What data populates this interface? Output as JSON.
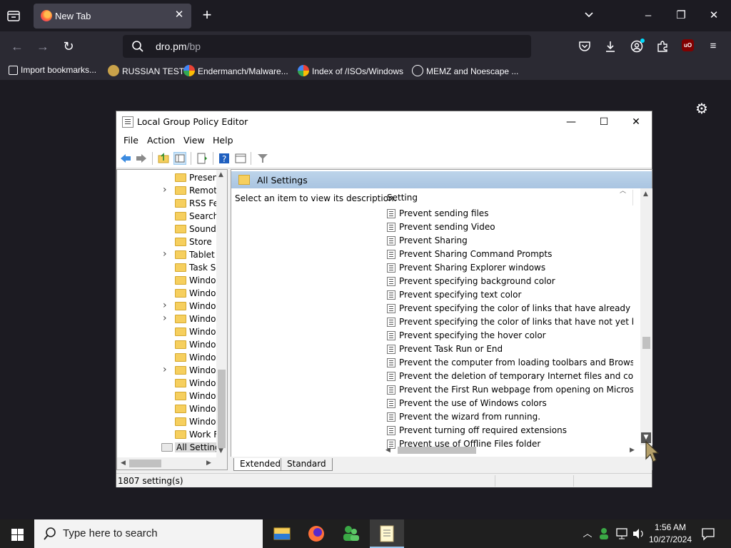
{
  "browser": {
    "tab": {
      "title": "New Tab"
    },
    "url": {
      "host": "dro.pm",
      "path": "/bp"
    },
    "bookmarks": [
      {
        "label": "Import bookmarks...",
        "icon": "import-icon"
      },
      {
        "label": "RUSSIAN TEST",
        "icon": "russian-test-icon"
      },
      {
        "label": "Endermanch/Malware...",
        "icon": "google-icon"
      },
      {
        "label": "Index of /ISOs/Windows",
        "icon": "google-icon"
      },
      {
        "label": "MEMZ and Noescape ...",
        "icon": "globe-icon"
      }
    ],
    "ublock_badge": "uO"
  },
  "gpedit": {
    "title": "Local Group Policy Editor",
    "menu": [
      "File",
      "Action",
      "View",
      "Help"
    ],
    "tree": [
      {
        "label": "Presen",
        "expandable": false
      },
      {
        "label": "Remot",
        "expandable": true
      },
      {
        "label": "RSS Fe",
        "expandable": false
      },
      {
        "label": "Search",
        "expandable": false
      },
      {
        "label": "Sound",
        "expandable": false
      },
      {
        "label": "Store",
        "expandable": false
      },
      {
        "label": "Tablet",
        "expandable": true
      },
      {
        "label": "Task Sc",
        "expandable": false
      },
      {
        "label": "Windo",
        "expandable": false
      },
      {
        "label": "Windo",
        "expandable": false
      },
      {
        "label": "Windo",
        "expandable": true
      },
      {
        "label": "Windo",
        "expandable": true
      },
      {
        "label": "Windo",
        "expandable": false
      },
      {
        "label": "Windo",
        "expandable": false
      },
      {
        "label": "Windo",
        "expandable": false
      },
      {
        "label": "Windo",
        "expandable": true
      },
      {
        "label": "Windo",
        "expandable": false
      },
      {
        "label": "Windo",
        "expandable": false
      },
      {
        "label": "Windo",
        "expandable": false
      },
      {
        "label": "Windo",
        "expandable": false
      },
      {
        "label": "Work F",
        "expandable": false
      }
    ],
    "tree_selected": "All Setting",
    "detail_title": "All Settings",
    "description": "Select an item to view its description.",
    "column_header": "Setting",
    "settings": [
      "Prevent sending files",
      "Prevent sending Video",
      "Prevent Sharing",
      "Prevent Sharing Command Prompts",
      "Prevent Sharing Explorer windows",
      "Prevent specifying background color",
      "Prevent specifying text color",
      "Prevent specifying the color of links that have already been ...",
      "Prevent specifying the color of links that have not yet been ...",
      "Prevent specifying the hover color",
      "Prevent Task Run or End",
      "Prevent the computer from loading toolbars and Browser H...",
      "Prevent the deletion of temporary Internet files and cookies",
      "Prevent the First Run webpage from opening on Microsoft E...",
      "Prevent the use of Windows colors",
      "Prevent the wizard from running.",
      "Prevent turning off required extensions",
      "Prevent use of Offline Files folder"
    ],
    "tabs": [
      "Extended",
      "Standard"
    ],
    "status": "1807 setting(s)"
  },
  "taskbar": {
    "search_placeholder": "Type here to search",
    "time": "1:56 AM",
    "date": "10/27/2024"
  }
}
